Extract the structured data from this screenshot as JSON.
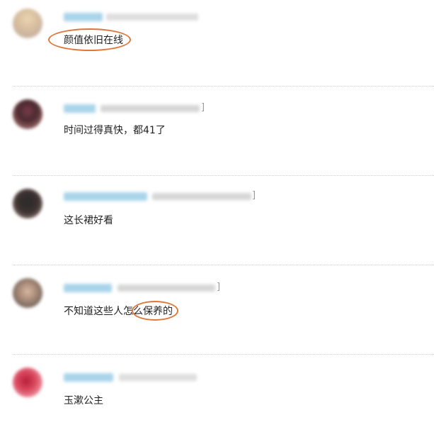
{
  "comments": [
    {
      "text": "颜值依旧在线",
      "meta_suffix": ""
    },
    {
      "text": "时间过得真快，都41了",
      "meta_suffix": "]"
    },
    {
      "text": "这长裙好看",
      "meta_suffix": "]"
    },
    {
      "text": "不知道这些人怎么保养的",
      "meta_suffix": "]"
    },
    {
      "text": "玉漱公主",
      "meta_suffix": ""
    }
  ],
  "colors": {
    "username_blur": "#a9d4ea",
    "meta_blur": "#d6d6d6",
    "annotation_circle": "#e0773a",
    "divider": "#cfcfcf"
  }
}
